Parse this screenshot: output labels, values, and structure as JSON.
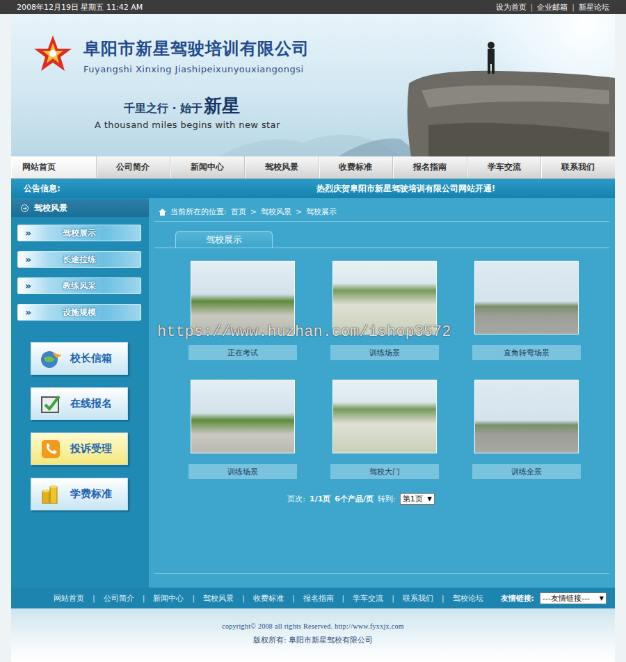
{
  "topbar": {
    "date": "2008年12月19日 星期五 11:42 AM",
    "links": [
      "设为首页",
      "企业邮箱",
      "新星论坛"
    ],
    "separator": "|"
  },
  "header": {
    "company": "阜阳市新星驾驶培训有限公司",
    "pinyin": "Fuyangshi Xinxing Jiashipeixunyouxiangongsi",
    "slogan": "千里之行 · 始于",
    "slogan_emphasis": "新星",
    "slogan_en": "A thousand miles begins with new star"
  },
  "nav": [
    {
      "label": "网站首页",
      "selected": true
    },
    {
      "label": "公司简介",
      "selected": false
    },
    {
      "label": "新闻中心",
      "selected": false
    },
    {
      "label": "驾校风景",
      "selected": false
    },
    {
      "label": "收费标准",
      "selected": false
    },
    {
      "label": "报名指南",
      "selected": false
    },
    {
      "label": "学车交流",
      "selected": false
    },
    {
      "label": "联系我们",
      "selected": false
    }
  ],
  "notice": {
    "label": "公告信息:",
    "text": "热烈庆贺阜阳市新星驾驶培训有限公司网站开通!"
  },
  "sidebar": {
    "title": "驾校风景",
    "bullet": "»",
    "items": [
      {
        "label": "驾校展示"
      },
      {
        "label": "长途拉练"
      },
      {
        "label": "教练风采"
      },
      {
        "label": "设施规模"
      }
    ],
    "buttons": [
      {
        "label": "校长信箱",
        "kind": "mail"
      },
      {
        "label": "在线报名",
        "kind": "signup"
      },
      {
        "label": "投诉受理",
        "kind": "complaint"
      },
      {
        "label": "学费标准",
        "kind": "fee"
      }
    ]
  },
  "breadcrumb": {
    "label": "当前所在的位置:",
    "path": [
      "首页",
      "驾校风景",
      "驾校展示"
    ],
    "separator": ">"
  },
  "tab": {
    "label": "驾校展示"
  },
  "gallery": [
    {
      "caption": "正在考试"
    },
    {
      "caption": "训练场景"
    },
    {
      "caption": "直角转弯场景"
    },
    {
      "caption": "训练场景"
    },
    {
      "caption": "驾校大门"
    },
    {
      "caption": "训练全景"
    }
  ],
  "pagination": {
    "label": "页次:",
    "pages": "1/1页",
    "per_page": "6个产品/页",
    "goto": "转到:",
    "select": "第1页",
    "arrow": "▼"
  },
  "footer": {
    "links": [
      "网站首页",
      "公司简介",
      "新闻中心",
      "驾校风景",
      "收费标准",
      "报名指南",
      "学车交流",
      "联系我们",
      "驾校论坛"
    ],
    "separator": "|",
    "friend_label": "友情链接:",
    "friend_select": "---友情链接---",
    "arrow": "▼"
  },
  "copyright": {
    "line": "copyright© 2008 all rights Reserved. http://www.fyxxjx.com",
    "owner": "版权所有: 阜阳市新星驾校有限公司"
  },
  "watermark": "https://www.huzhan.com/ishop3572"
}
